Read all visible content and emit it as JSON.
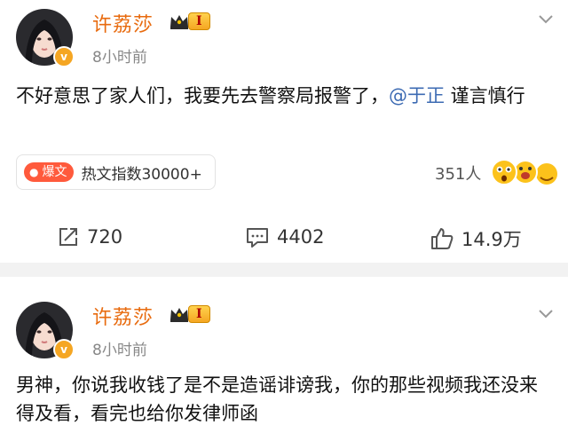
{
  "posts": [
    {
      "author": "许荔莎",
      "level": "I",
      "time": "8小时前",
      "text_before": "不好意思了家人们，我要先去警察局报警了，",
      "mention": "@于正",
      "text_after": " 谨言慎行",
      "hot_tag": "爆文",
      "hot_index": "热文指数30000+",
      "people_count": "351人",
      "repost_count": "720",
      "comment_count": "4402",
      "like_count": "14.9万"
    },
    {
      "author": "许荔莎",
      "level": "I",
      "time": "8小时前",
      "text": "男神，你说我收钱了是不是造谣诽谤我，你的那些视频我还没来得及看，看完也给你发律师函"
    }
  ],
  "colors": {
    "name": "#e86b0f",
    "mention": "#3d6bb3",
    "hot_tag": "#ff5a3c",
    "badge": "#f5a623"
  },
  "icons": {
    "repost": "repost-icon",
    "comment": "comment-icon",
    "like": "like-icon",
    "menu": "chevron-down-icon",
    "verified": "verified-v-icon"
  }
}
